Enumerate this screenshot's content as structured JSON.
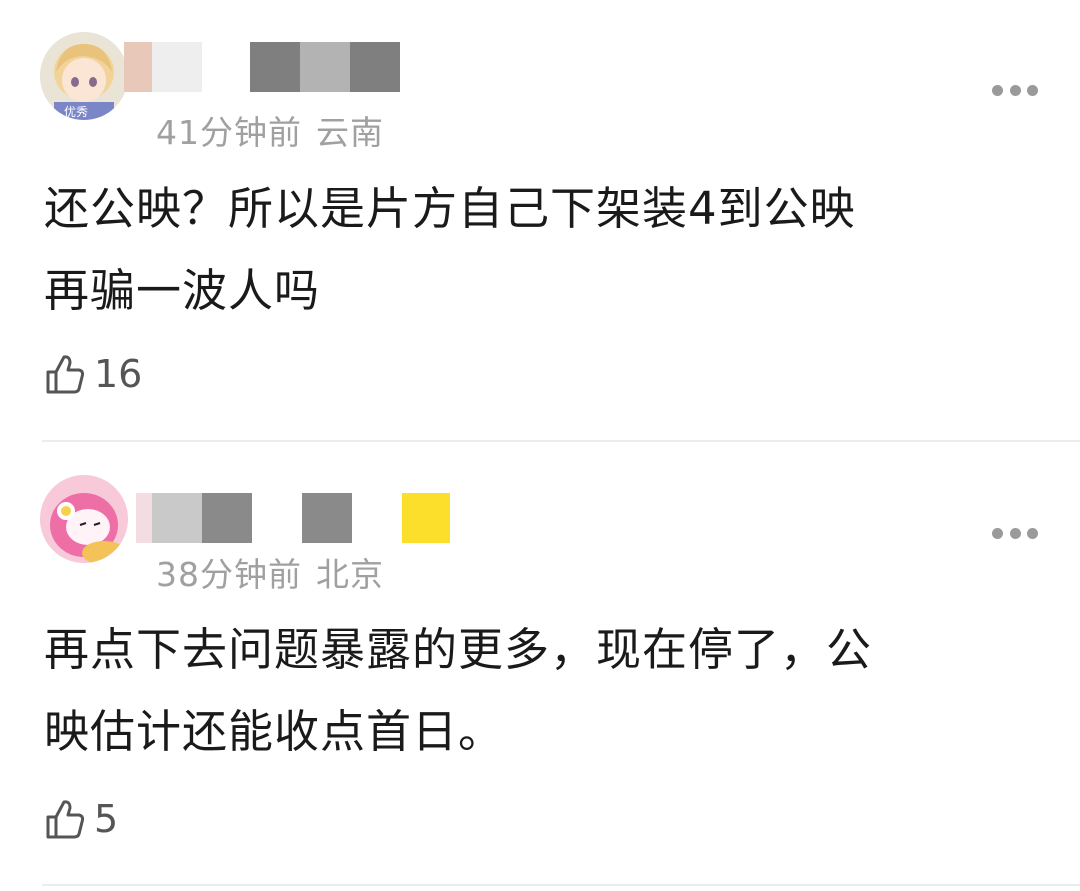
{
  "comments": [
    {
      "time": "41分钟前",
      "location": "云南",
      "text_lines": [
        "还公映？所以是片方自己下架装4到公映",
        "再骗一波人吗"
      ],
      "likes": "16",
      "avatar_badge": "优秀",
      "avatar_icon": "anime-boy-avatar",
      "name_mosaic_colors": [
        "#e8c8b8",
        "#eeeeee",
        "#ffffff",
        "#7f7f7f",
        "#b3b3b3",
        "#7f7f7f"
      ]
    },
    {
      "time": "38分钟前",
      "location": "北京",
      "text_lines": [
        "再点下去问题暴露的更多，现在停了，公",
        "映估计还能收点首日。"
      ],
      "likes": "5",
      "avatar_icon": "pink-rabbit-avatar",
      "name_mosaic_colors": [
        "#f2dde2",
        "#c9c9c9",
        "#8a8a8a",
        "#ffffff",
        "#8a8a8a",
        "#ffffff",
        "#fcdf2a"
      ]
    }
  ],
  "colors": {
    "meta_text": "#a0a0a0",
    "divider": "#ececec",
    "dots": "#9a9a9a"
  }
}
